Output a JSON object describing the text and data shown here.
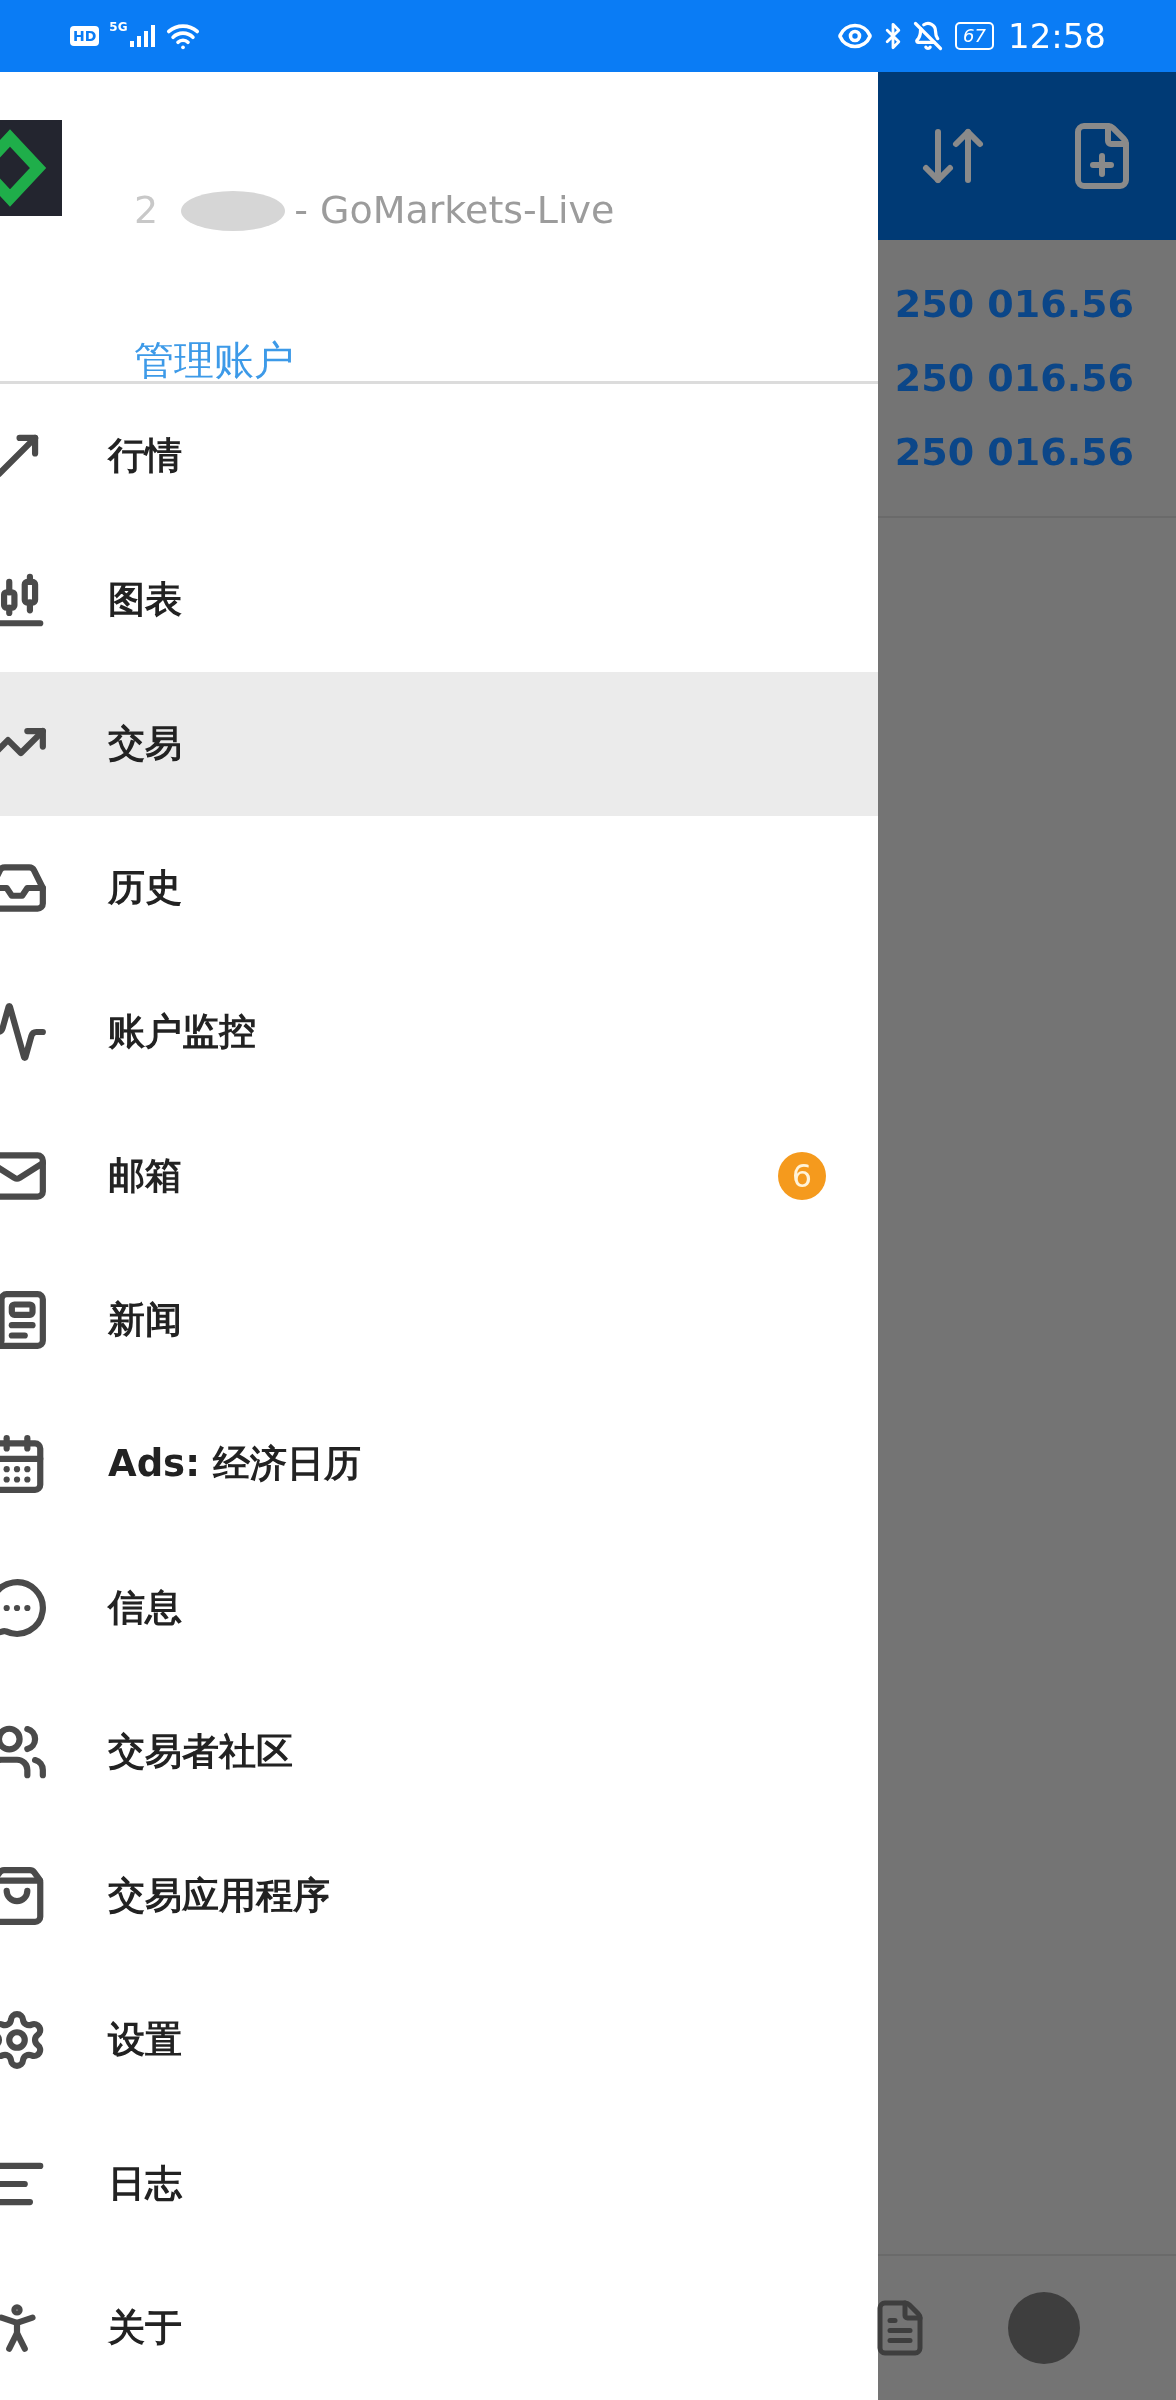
{
  "status_bar": {
    "hd": "HD",
    "network": "5G",
    "battery": "67",
    "time": "12:58"
  },
  "drawer": {
    "account_prefix": "2",
    "account_name": "- GoMarkets-Live",
    "manage_link": "管理账户",
    "items": [
      {
        "label": "行情",
        "selected": false
      },
      {
        "label": "图表",
        "selected": false
      },
      {
        "label": "交易",
        "selected": true
      },
      {
        "label": "历史",
        "selected": false
      },
      {
        "label": "账户监控",
        "selected": false
      },
      {
        "label": "邮箱",
        "selected": false,
        "badge": "6"
      },
      {
        "label": "新闻",
        "selected": false
      },
      {
        "label": "Ads: 经济日历",
        "selected": false
      },
      {
        "label": "信息",
        "selected": false
      },
      {
        "label": "交易者社区",
        "selected": false
      },
      {
        "label": "交易应用程序",
        "selected": false
      },
      {
        "label": "设置",
        "selected": false
      },
      {
        "label": "日志",
        "selected": false
      },
      {
        "label": "关于",
        "selected": false
      }
    ]
  },
  "background": {
    "values": [
      "250 016.56",
      "250 016.56",
      "250 016.56"
    ]
  }
}
